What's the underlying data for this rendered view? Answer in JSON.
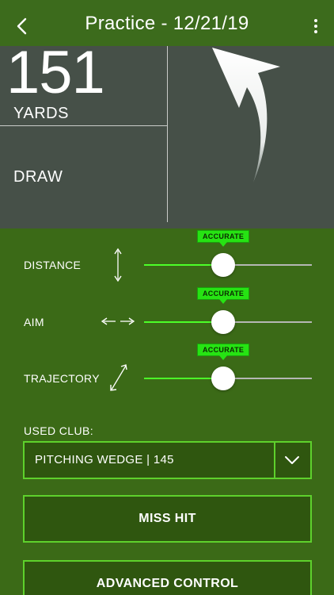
{
  "header": {
    "title": "Practice - 12/21/19",
    "back_icon": "chevron-left-icon",
    "menu_icon": "more-vertical-icon"
  },
  "summary": {
    "distance_value": "151",
    "distance_unit": "YARDS",
    "shot_shape": "DRAW"
  },
  "controls": [
    {
      "label": "DISTANCE",
      "icon": "vertical-arrows-icon",
      "badge": "ACCURATE",
      "level": 0.5
    },
    {
      "label": "AIM",
      "icon": "horizontal-arrows-icon",
      "badge": "ACCURATE",
      "level": 0.5
    },
    {
      "label": "TRAJECTORY",
      "icon": "diagonal-arrows-icon",
      "badge": "ACCURATE",
      "level": 0.5
    }
  ],
  "club": {
    "label": "USED CLUB:",
    "value": "PITCHING WEDGE | 145",
    "dropdown_icon": "chevron-down-icon"
  },
  "buttons": {
    "miss_hit": "MISS HIT",
    "advanced_control": "ADVANCED CONTROL"
  },
  "colors": {
    "background": "#3b6a17",
    "panel": "#465048",
    "accent": "#5ed12c",
    "badge": "#26e313",
    "track_active": "#4cff28"
  }
}
